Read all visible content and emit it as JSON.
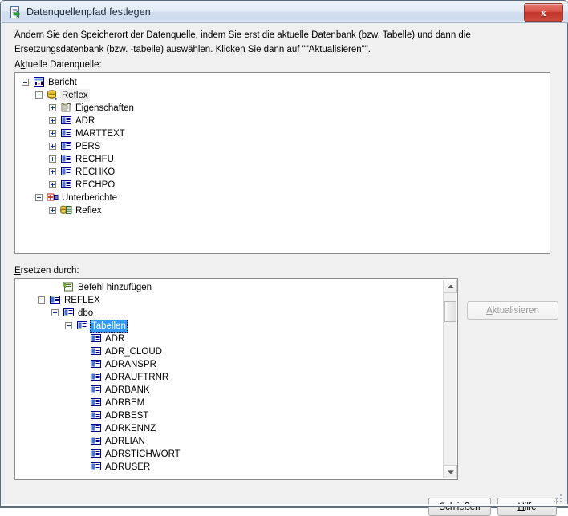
{
  "window": {
    "title": "Datenquellenpfad festlegen",
    "title_icon": "datasource-location-icon",
    "close_label": "x"
  },
  "instructions": "Ändern Sie den Speicherort der Datenquelle, indem Sie erst die aktuelle Datenbank (bzw. Tabelle) und dann die Ersetzungsdatenbank (bzw. -tabelle) auswählen. Klicken Sie dann auf \"\"Aktualisieren\"\".",
  "labels": {
    "current_source": "Aktuelle Datenquelle:",
    "replace_with": "Ersetzen durch:"
  },
  "current_tree": [
    {
      "label": "Bericht",
      "depth": 0,
      "expander": "minus",
      "icon": "report-icon"
    },
    {
      "label": "Reflex",
      "depth": 1,
      "expander": "minus",
      "icon": "database-icon",
      "focus": true
    },
    {
      "label": "Eigenschaften",
      "depth": 2,
      "expander": "plus",
      "icon": "properties-icon"
    },
    {
      "label": "ADR",
      "depth": 2,
      "expander": "plus",
      "icon": "table-icon"
    },
    {
      "label": "MARTTEXT",
      "depth": 2,
      "expander": "plus",
      "icon": "table-icon"
    },
    {
      "label": "PERS",
      "depth": 2,
      "expander": "plus",
      "icon": "table-icon"
    },
    {
      "label": "RECHFU",
      "depth": 2,
      "expander": "plus",
      "icon": "table-icon"
    },
    {
      "label": "RECHKO",
      "depth": 2,
      "expander": "plus",
      "icon": "table-icon"
    },
    {
      "label": "RECHPO",
      "depth": 2,
      "expander": "plus",
      "icon": "table-icon"
    },
    {
      "label": "Unterberichte",
      "depth": 1,
      "expander": "minus",
      "icon": "subreports-icon"
    },
    {
      "label": "Reflex",
      "depth": 2,
      "expander": "plus",
      "icon": "subreport-database-icon"
    }
  ],
  "replace_tree": [
    {
      "label": "Befehl hinzufügen",
      "depth": 3,
      "expander": "none",
      "icon": "add-command-icon"
    },
    {
      "label": "REFLEX",
      "depth": 2,
      "expander": "minus",
      "icon": "table-icon"
    },
    {
      "label": "dbo",
      "depth": 3,
      "expander": "minus",
      "icon": "table-icon"
    },
    {
      "label": "Tabellen",
      "depth": 4,
      "expander": "minus",
      "icon": "table-icon",
      "selected": true
    },
    {
      "label": "ADR",
      "depth": 5,
      "expander": "none",
      "icon": "table-icon"
    },
    {
      "label": "ADR_CLOUD",
      "depth": 5,
      "expander": "none",
      "icon": "table-icon"
    },
    {
      "label": "ADRANSPR",
      "depth": 5,
      "expander": "none",
      "icon": "table-icon"
    },
    {
      "label": "ADRAUFTRNR",
      "depth": 5,
      "expander": "none",
      "icon": "table-icon"
    },
    {
      "label": "ADRBANK",
      "depth": 5,
      "expander": "none",
      "icon": "table-icon"
    },
    {
      "label": "ADRBEM",
      "depth": 5,
      "expander": "none",
      "icon": "table-icon"
    },
    {
      "label": "ADRBEST",
      "depth": 5,
      "expander": "none",
      "icon": "table-icon"
    },
    {
      "label": "ADRKENNZ",
      "depth": 5,
      "expander": "none",
      "icon": "table-icon"
    },
    {
      "label": "ADRLIAN",
      "depth": 5,
      "expander": "none",
      "icon": "table-icon"
    },
    {
      "label": "ADRSTICHWORT",
      "depth": 5,
      "expander": "none",
      "icon": "table-icon"
    },
    {
      "label": "ADRUSER",
      "depth": 5,
      "expander": "none",
      "icon": "table-icon"
    }
  ],
  "buttons": {
    "update": {
      "label": "Aktualisieren",
      "accel": "A",
      "disabled": true
    },
    "close": {
      "label": "Schließen",
      "accel": "",
      "disabled": false
    },
    "help": {
      "label": "Hilfe",
      "accel": "H",
      "disabled": false
    }
  },
  "scrollbar": {
    "up_arrow": "scroll-up-icon",
    "down_arrow": "scroll-down-icon",
    "thumb_position_percent": 4
  },
  "colors": {
    "selection_blue": "#3399ff",
    "title_gradient_top": "#eef3fa",
    "title_gradient_bottom": "#cddcef",
    "close_red": "#bf332a",
    "panel_bg": "#ffffff",
    "dialog_bg": "#f0f0f0"
  }
}
